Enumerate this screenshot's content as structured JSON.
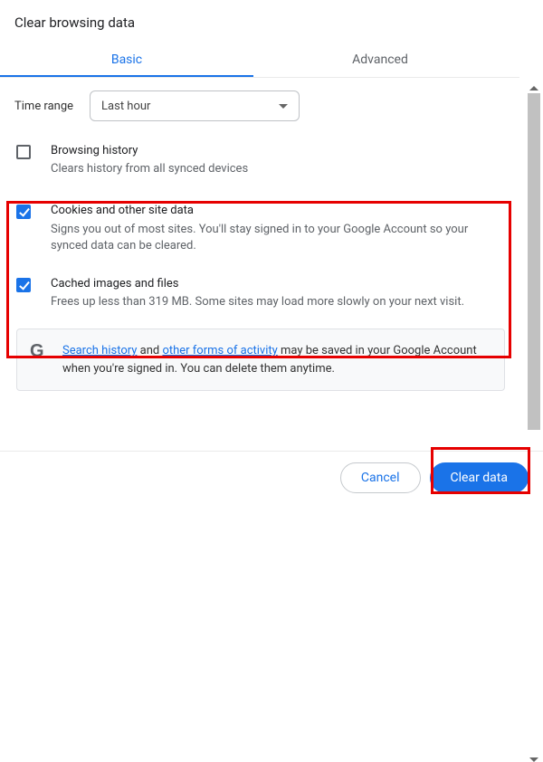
{
  "title": "Clear browsing data",
  "tabs": {
    "basic": "Basic",
    "advanced": "Advanced"
  },
  "time": {
    "label": "Time range",
    "value": "Last hour"
  },
  "options": {
    "browsing_history": {
      "title": "Browsing history",
      "desc": "Clears history from all synced devices",
      "checked": false
    },
    "cookies": {
      "title": "Cookies and other site data",
      "desc": "Signs you out of most sites. You'll stay signed in to your Google Account so your synced data can be cleared.",
      "checked": true
    },
    "cache": {
      "title": "Cached images and files",
      "desc": "Frees up less than 319 MB. Some sites may load more slowly on your next visit.",
      "checked": true
    }
  },
  "info": {
    "icon_letter": "G",
    "link1": "Search history",
    "mid1": " and ",
    "link2": "other forms of activity",
    "rest": " may be saved in your Google Account when you're signed in. You can delete them anytime."
  },
  "footer": {
    "cancel": "Cancel",
    "clear": "Clear data"
  }
}
